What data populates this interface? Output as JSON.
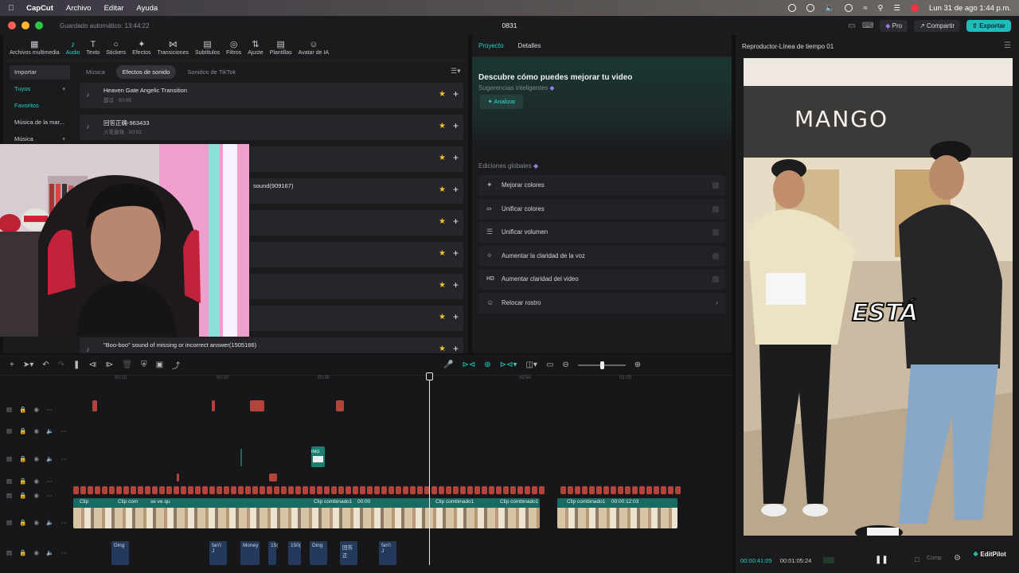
{
  "menubar": {
    "app": "CapCut",
    "items": [
      "Archivo",
      "Editar",
      "Ayuda"
    ],
    "clock": "Lun 31 de ago  1:44 p.m."
  },
  "titlebar": {
    "autosave": "Guardado automático: 13:44:22",
    "project": "0831",
    "pro": "Pro",
    "share": "Compartir",
    "export": "Exportar"
  },
  "toolbar": {
    "tools": [
      {
        "label": "Archivos multimedia",
        "icon": "media-icon"
      },
      {
        "label": "Audio",
        "icon": "audio-icon"
      },
      {
        "label": "Texto",
        "icon": "text-icon"
      },
      {
        "label": "Stickers",
        "icon": "sticker-icon"
      },
      {
        "label": "Efectos",
        "icon": "effects-icon"
      },
      {
        "label": "Transiciones",
        "icon": "transition-icon"
      },
      {
        "label": "Subtítulos",
        "icon": "captions-icon"
      },
      {
        "label": "Filtros",
        "icon": "filter-icon"
      },
      {
        "label": "Ajuste",
        "icon": "adjust-icon"
      },
      {
        "label": "Plantillas",
        "icon": "templates-icon"
      },
      {
        "label": "Avatar de IA",
        "icon": "avatar-icon"
      }
    ]
  },
  "sidenav": {
    "items": [
      "Importar",
      "Tuyos",
      "Favoritos",
      "Música de la mar...",
      "Música"
    ]
  },
  "subtabs": [
    "Música",
    "Efectos de sonido",
    "Sonidos de TikTok"
  ],
  "sounds": [
    {
      "name": "Heaven Gate Angelic Transition",
      "meta": "甜瓜 · 00:05"
    },
    {
      "name": "回答正确-963433",
      "meta": "火花音效 · 00:02"
    },
    {
      "name": "",
      "meta": ""
    },
    {
      "name": "sound(909167)",
      "meta": ""
    },
    {
      "name": "",
      "meta": ""
    },
    {
      "name": "",
      "meta": ""
    },
    {
      "name": "",
      "meta": ""
    },
    {
      "name": "",
      "meta": ""
    },
    {
      "name": "\"Boo-boo\" sound of missing or incorrect answer(1505166)",
      "meta": ""
    }
  ],
  "project_panel": {
    "tabs": [
      "Proyecto",
      "Detalles"
    ],
    "smart_label": "Sugerencias inteligentes",
    "smart_title": "Descubre cómo puedes mejorar tu video",
    "analyze": "Analizar",
    "global_label": "Ediciones globales",
    "edits": [
      {
        "label": "Mejorar colores",
        "icon": "color-wand-icon"
      },
      {
        "label": "Unificar colores",
        "icon": "link-icon"
      },
      {
        "label": "Unificar volumen",
        "icon": "volume-bars-icon"
      },
      {
        "label": "Aumentar la claridad de la voz",
        "icon": "sparkle-icon"
      },
      {
        "label": "Aumentar claridad del video",
        "icon": "hd-icon"
      },
      {
        "label": "Retocar rostro",
        "icon": "face-icon"
      }
    ]
  },
  "player": {
    "title": "Reproductor-Línea de tiempo 01",
    "store_sign": "MANGO",
    "caption": "ESTÁ",
    "current": "00:00:41:05",
    "total": "00:01:05:24"
  },
  "timeline": {
    "ticks": [
      "00:10",
      "00:20",
      "00:30",
      "00:50",
      "01:00"
    ],
    "clip_labels": [
      "Clip",
      "Clip com",
      "se ve qu",
      "Clip combinado1",
      "00:00",
      "Clip combinado1",
      "Clip combinado1",
      "Clip combinado1",
      "00:00:12:03"
    ],
    "audio_labels": [
      "Ding",
      "fan'l J",
      "Money",
      "15(",
      "150(",
      "Ding",
      "回答正",
      "fan'l J"
    ],
    "img_label": "IMG"
  },
  "editpilot": "EditPilot",
  "colors": {
    "accent": "#1fd0c8",
    "effect_clip": "#b2443c",
    "video_clip": "#176b62",
    "audio_clip": "#243a5c"
  }
}
